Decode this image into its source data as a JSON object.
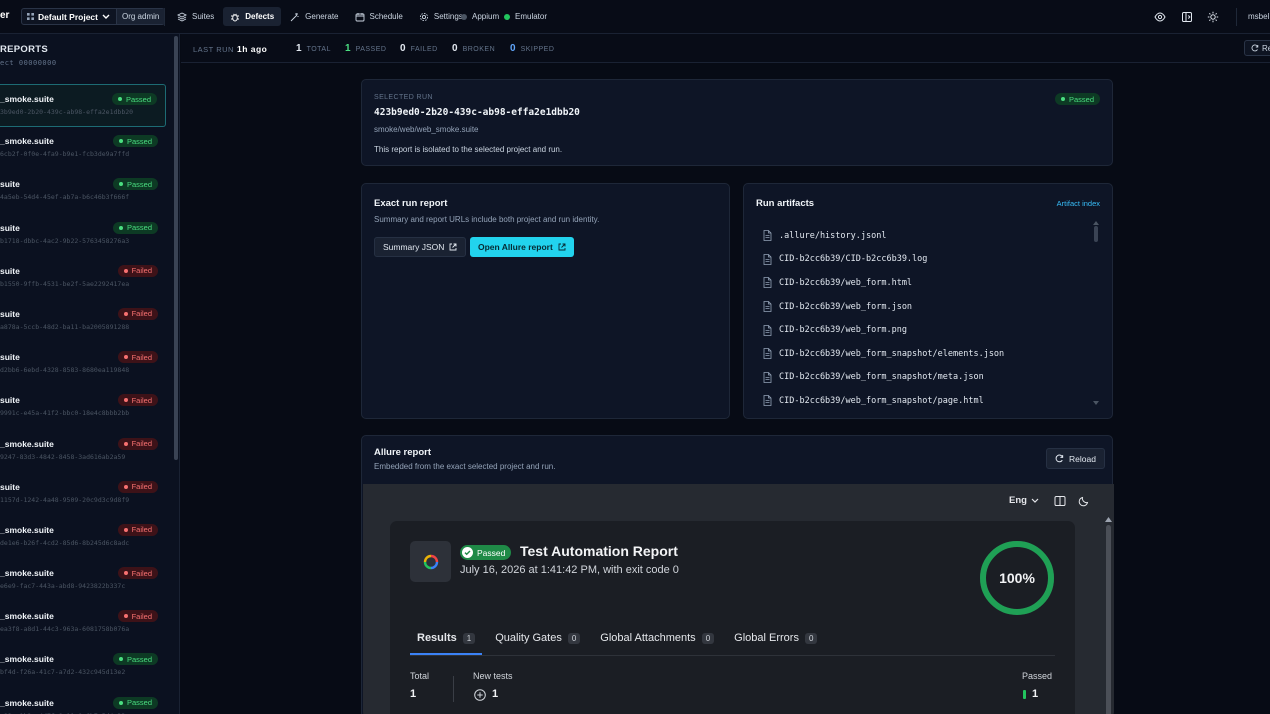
{
  "topbar": {
    "brand": "er",
    "project": "Default Project",
    "role": "Org admin",
    "nav": [
      {
        "label": "Suites",
        "icon": "layers-icon",
        "active": false
      },
      {
        "label": "Defects",
        "icon": "bug-icon",
        "active": true
      },
      {
        "label": "Generate",
        "icon": "wand-icon",
        "active": false
      },
      {
        "label": "Schedule",
        "icon": "calendar-icon",
        "active": false
      },
      {
        "label": "Settings",
        "icon": "gear-icon",
        "active": false
      }
    ],
    "status_appium": "Appium",
    "status_emulator": "Emulator",
    "user": "msbel"
  },
  "sidebar": {
    "title": "REPORTS",
    "subtitle": "ect 00000000",
    "runs": [
      {
        "name": "_smoke.suite",
        "id": "3b9ed0-2b20-439c-ab98-effa2e1dbb20",
        "status": "Passed"
      },
      {
        "name": "_smoke.suite",
        "id": "6cb2f-0f0e-4fa9-b9e1-fcb3de9a7ffd",
        "status": "Passed"
      },
      {
        "name": "suite",
        "id": "4a5eb-54d4-45ef-ab7a-b6c46b3f666f",
        "status": "Passed"
      },
      {
        "name": "suite",
        "id": "b1718-dbbc-4ac2-9b22-5763458276a3",
        "status": "Passed"
      },
      {
        "name": "suite",
        "id": "b1550-9ffb-4531-be2f-5ae2292417ea",
        "status": "Failed"
      },
      {
        "name": "suite",
        "id": "a878a-5ccb-48d2-ba11-ba2005891288",
        "status": "Failed"
      },
      {
        "name": "suite",
        "id": "d2bb6-6ebd-4328-8583-8680ea119848",
        "status": "Failed"
      },
      {
        "name": "suite",
        "id": "9991c-e45a-41f2-bbc0-18e4c8bbb2bb",
        "status": "Failed"
      },
      {
        "name": "_smoke.suite",
        "id": "9247-83d3-4842-8458-3ad616ab2a59",
        "status": "Failed"
      },
      {
        "name": "suite",
        "id": "1157d-1242-4a48-9509-20c9d3c9d8f9",
        "status": "Failed"
      },
      {
        "name": "_smoke.suite",
        "id": "de1e6-b26f-4cd2-85d6-8b245d6c8adc",
        "status": "Failed"
      },
      {
        "name": "_smoke.suite",
        "id": "e6e9-fac7-443a-abd8-9423822b337c",
        "status": "Failed"
      },
      {
        "name": "_smoke.suite",
        "id": "ea3f8-a8d1-44c3-963a-6081758b076a",
        "status": "Failed"
      },
      {
        "name": "_smoke.suite",
        "id": "bf4d-f26a-41c7-a7d2-432c945d13e2",
        "status": "Passed"
      },
      {
        "name": "_smoke.suite",
        "id": "c83a-1b2e-4d7f-9e11-0a6b7c5d4e33",
        "status": "Passed"
      }
    ]
  },
  "stats": {
    "last_run_label": "LAST RUN",
    "last_run_value": "1h ago",
    "total": "1",
    "total_label": "TOTAL",
    "passed": "1",
    "passed_label": "PASSED",
    "failed": "0",
    "failed_label": "FAILED",
    "broken": "0",
    "broken_label": "BROKEN",
    "skipped": "0",
    "skipped_label": "SKIPPED",
    "refresh": "Ref"
  },
  "selected_run": {
    "label": "SELECTED RUN",
    "id": "423b9ed0-2b20-439c-ab98-effa2e1dbb20",
    "path": "smoke/web/web_smoke.suite",
    "note": "This report is isolated to the selected project and run.",
    "status": "Passed"
  },
  "exact_report": {
    "title": "Exact run report",
    "desc": "Summary and report URLs include both project and run identity.",
    "summary_btn": "Summary JSON",
    "open_btn": "Open Allure report"
  },
  "artifacts": {
    "title": "Run artifacts",
    "index_link": "Artifact index",
    "items": [
      ".allure/history.jsonl",
      "CID-b2cc6b39/CID-b2cc6b39.log",
      "CID-b2cc6b39/web_form.html",
      "CID-b2cc6b39/web_form.json",
      "CID-b2cc6b39/web_form.png",
      "CID-b2cc6b39/web_form_snapshot/elements.json",
      "CID-b2cc6b39/web_form_snapshot/meta.json",
      "CID-b2cc6b39/web_form_snapshot/page.html"
    ]
  },
  "allure": {
    "title": "Allure report",
    "desc": "Embedded from the exact selected project and run.",
    "reload": "Reload",
    "lang": "Eng",
    "badge": "Passed",
    "report_title": "Test Automation Report",
    "report_sub": "July 16, 2026 at 1:41:42 PM, with exit code 0",
    "percent": "100%",
    "percent_value": 100,
    "tabs": [
      {
        "label": "Results",
        "count": "1",
        "active": true
      },
      {
        "label": "Quality Gates",
        "count": "0",
        "active": false
      },
      {
        "label": "Global Attachments",
        "count": "0",
        "active": false
      },
      {
        "label": "Global Errors",
        "count": "0",
        "active": false
      }
    ],
    "total_label": "Total",
    "total_value": "1",
    "new_label": "New tests",
    "new_value": "1",
    "passed_label": "Passed",
    "passed_value": "1"
  },
  "colors": {
    "accent": "#22d3ee",
    "passed": "#4ade80",
    "failed": "#f87171",
    "broken": "#e2e8f0",
    "skipped": "#60a5fa",
    "allure_green": "#1f8a47"
  }
}
